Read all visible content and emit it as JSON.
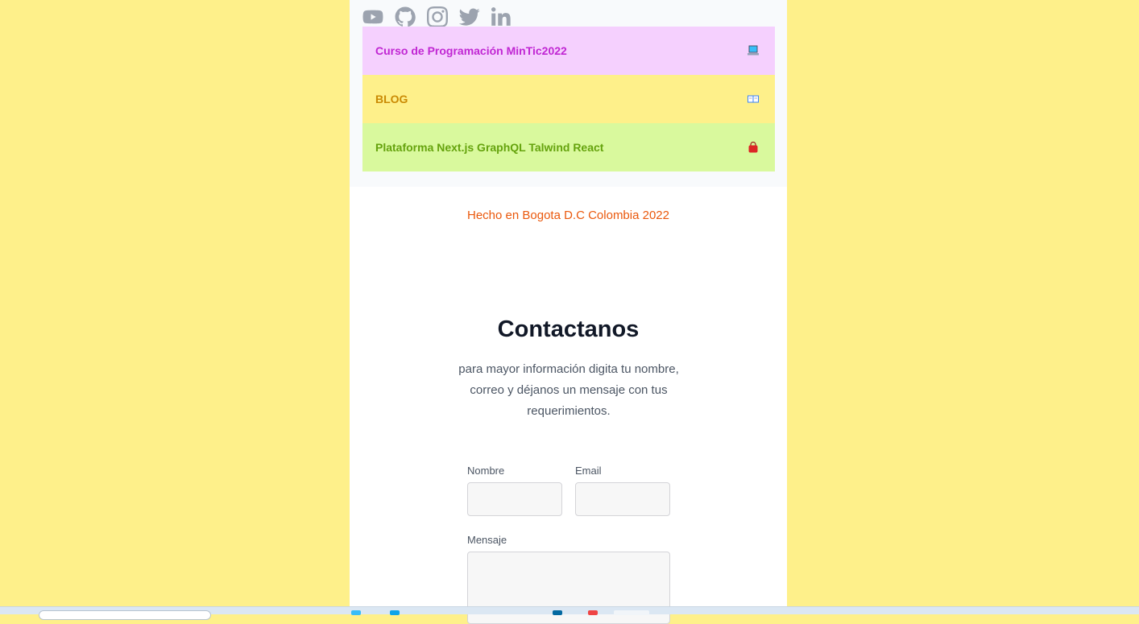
{
  "social": {
    "icons": [
      "youtube-icon",
      "github-icon",
      "instagram-icon",
      "twitter-icon",
      "linkedin-icon"
    ],
    "icon_color": "#9ca3af"
  },
  "links": [
    {
      "label": "Curso de Programación MinTic2022",
      "icon": "laptop-icon",
      "bg": "#f5d0fe",
      "color": "#c026d3"
    },
    {
      "label": "BLOG",
      "icon": "open-book-icon",
      "bg": "#fef08a",
      "color": "#ca8a04"
    },
    {
      "label": "Plataforma Next.js GraphQL Talwind React",
      "icon": "shopping-bag-icon",
      "bg": "#d9f99d",
      "color": "#65a30d"
    }
  ],
  "footer": {
    "made_in": "Hecho en Bogota D.C Colombia 2022"
  },
  "contact": {
    "title": "Contactanos",
    "description": "para mayor información digita tu nombre, correo y déjanos un mensaje con tus requerimientos.",
    "name_label": "Nombre",
    "name_value": "",
    "email_label": "Email",
    "email_value": "",
    "message_label": "Mensaje",
    "message_value": ""
  },
  "colors": {
    "page_background": "#fef08a",
    "accent_orange": "#ea580c"
  }
}
